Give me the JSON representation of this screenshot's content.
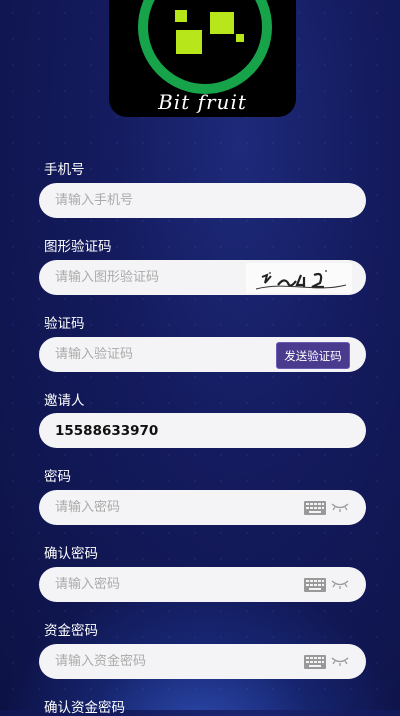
{
  "logo": {
    "text": "Bit fruit"
  },
  "form": {
    "phone": {
      "label": "手机号",
      "placeholder": "请输入手机号",
      "value": ""
    },
    "image_code": {
      "label": "图形验证码",
      "placeholder": "请输入图形验证码",
      "value": ""
    },
    "sms_code": {
      "label": "验证码",
      "placeholder": "请输入验证码",
      "value": "",
      "button": "发送验证码"
    },
    "inviter": {
      "label": "邀请人",
      "placeholder": "",
      "value": "15588633970"
    },
    "password": {
      "label": "密码",
      "placeholder": "请输入密码",
      "value": ""
    },
    "confirm_password": {
      "label": "确认密码",
      "placeholder": "请输入密码",
      "value": ""
    },
    "fund_password": {
      "label": "资金密码",
      "placeholder": "请输入资金密码",
      "value": ""
    },
    "confirm_fund_password": {
      "label": "确认资金密码"
    }
  },
  "icons": {
    "logo_ring": "logo-ring-icon",
    "keyboard": "keyboard-icon",
    "eye": "eye-closed-icon"
  },
  "colors": {
    "background": "#141b5e",
    "field": "#f4f4f6",
    "button": "#4a3b8f",
    "logo_green": "#17a34a",
    "logo_lime": "#b7e61b"
  }
}
